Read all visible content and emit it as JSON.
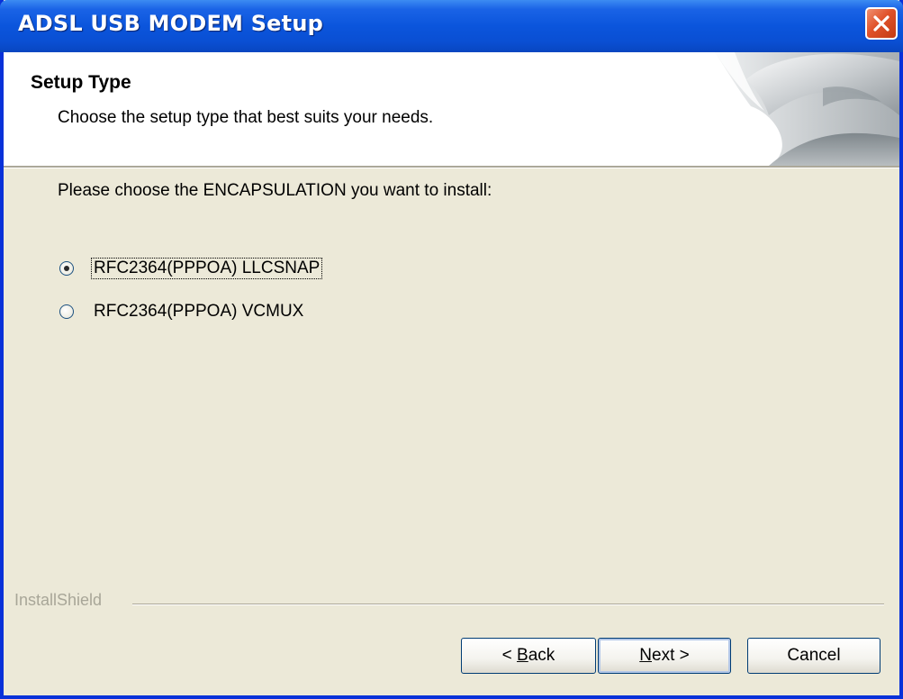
{
  "window": {
    "title": "ADSL USB MODEM Setup"
  },
  "header": {
    "title": "Setup Type",
    "subtitle": "Choose the setup type that best suits your needs."
  },
  "main": {
    "prompt": "Please choose the ENCAPSULATION you want to install:",
    "options": [
      {
        "label": "RFC2364(PPPOA) LLCSNAP",
        "selected": true
      },
      {
        "label": "RFC2364(PPPOA) VCMUX",
        "selected": false
      }
    ]
  },
  "footer": {
    "brand": "InstallShield",
    "back_prefix": "< ",
    "back_mnemonic": "B",
    "back_rest": "ack",
    "next_mnemonic": "N",
    "next_rest": "ext >",
    "cancel_label": "Cancel"
  },
  "icons": {
    "close": "close-icon",
    "header_art": "page-curl-graphic"
  },
  "colors": {
    "title_bar": "#0b55dc",
    "window_bg": "#ece9d8",
    "close_button": "#e0522a"
  }
}
